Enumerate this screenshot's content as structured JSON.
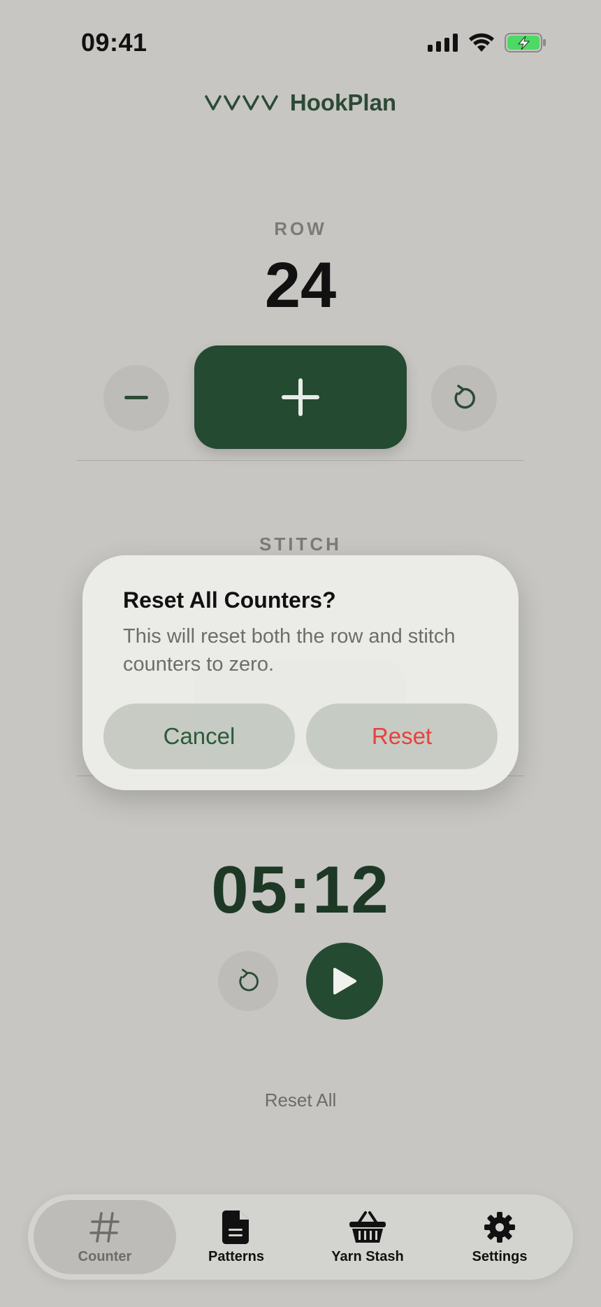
{
  "status": {
    "time": "09:41"
  },
  "brand": {
    "name": "HookPlan"
  },
  "row": {
    "label": "ROW",
    "value": "24"
  },
  "stitch": {
    "label": "STITCH"
  },
  "dialog": {
    "title": "Reset All Counters?",
    "message": "This will reset both the row and stitch counters to zero.",
    "cancel_label": "Cancel",
    "reset_label": "Reset"
  },
  "timer": {
    "value": "05:12"
  },
  "reset_all_label": "Reset All",
  "tabs": [
    {
      "label": "Counter",
      "icon": "hash-icon",
      "active": true
    },
    {
      "label": "Patterns",
      "icon": "document-icon",
      "active": false
    },
    {
      "label": "Yarn Stash",
      "icon": "basket-icon",
      "active": false
    },
    {
      "label": "Settings",
      "icon": "gear-icon",
      "active": false
    }
  ],
  "colors": {
    "accent": "#254a32",
    "destructive": "#e5423e",
    "battery": "#4cd964"
  }
}
